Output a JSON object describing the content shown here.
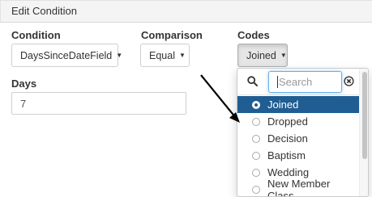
{
  "dialog": {
    "title": "Edit Condition"
  },
  "condition": {
    "label": "Condition",
    "value": "DaysSinceDateField"
  },
  "comparison": {
    "label": "Comparison",
    "value": "Equal"
  },
  "codes": {
    "label": "Codes",
    "value": "Joined"
  },
  "days": {
    "label": "Days",
    "value": "7"
  },
  "dropdown": {
    "search_placeholder": "Search",
    "options": [
      {
        "label": "Joined",
        "selected": true
      },
      {
        "label": "Dropped",
        "selected": false
      },
      {
        "label": "Decision",
        "selected": false
      },
      {
        "label": "Baptism",
        "selected": false
      },
      {
        "label": "Wedding",
        "selected": false
      },
      {
        "label": "New Member Class",
        "selected": false
      }
    ]
  },
  "colors": {
    "selected": "#1f5d93",
    "focus": "#66afe9",
    "arrow": "#000000"
  },
  "icons": [
    "search-icon",
    "clear-icon",
    "caret-down-icon",
    "annotation-arrow"
  ]
}
